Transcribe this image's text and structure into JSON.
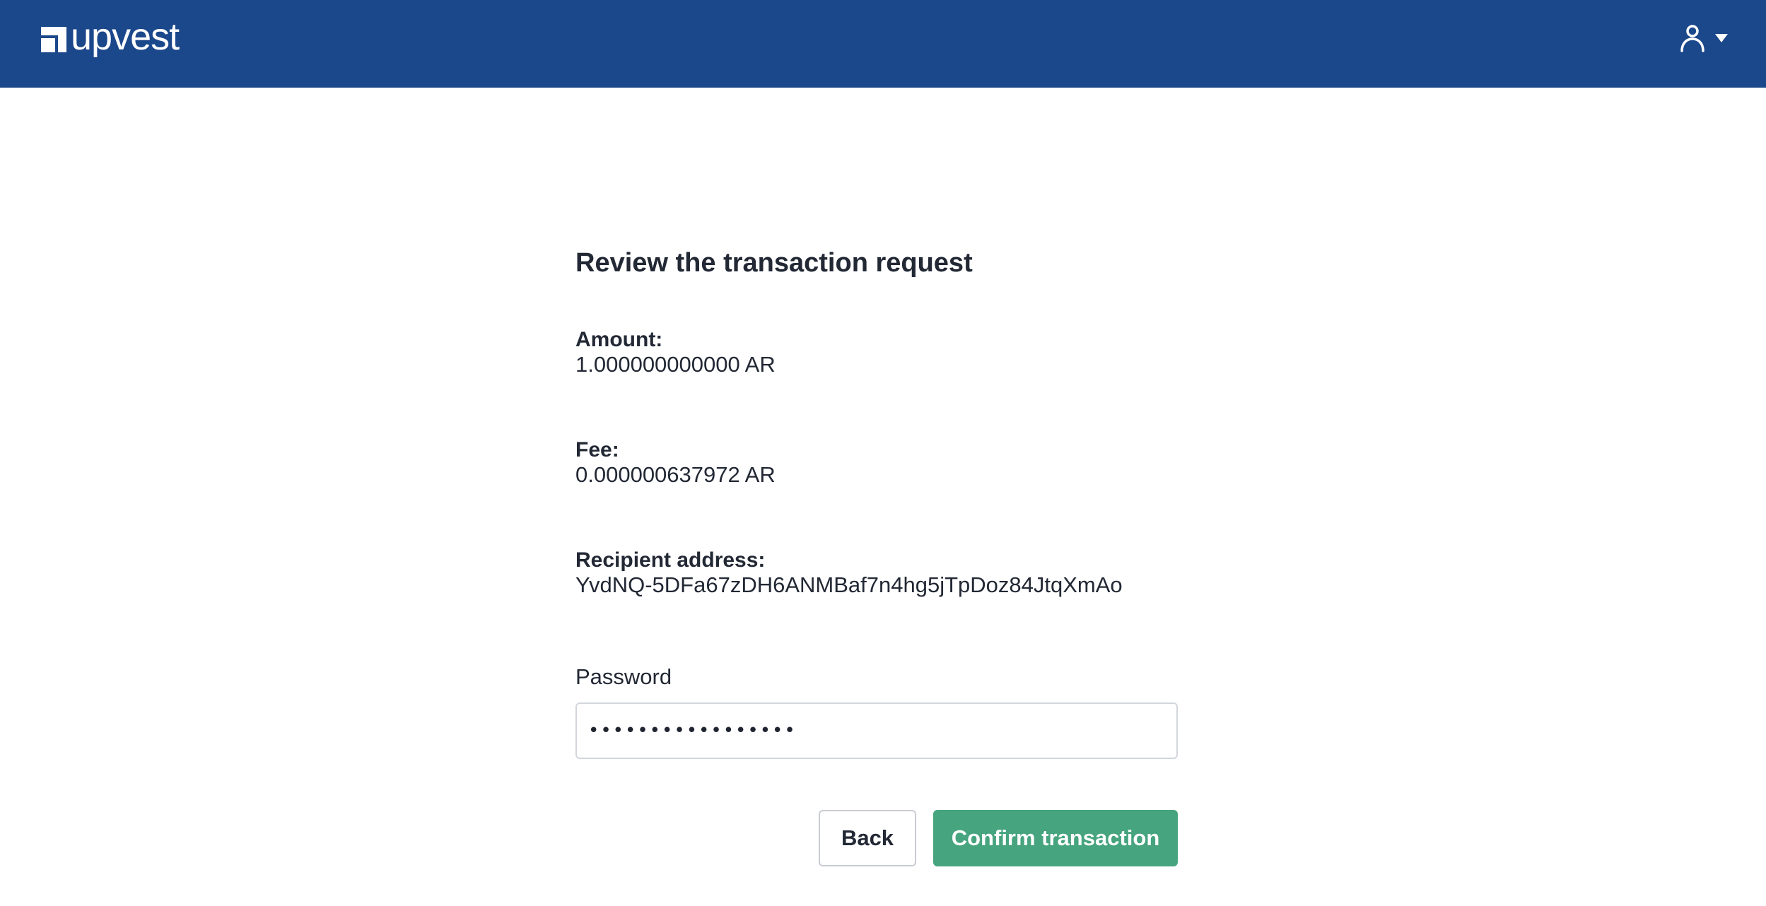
{
  "header": {
    "brand": "upvest",
    "brand_color": "#1b478b",
    "user_icon": "user-icon",
    "menu_icon": "chevron-down-icon"
  },
  "main": {
    "title": "Review the transaction request",
    "amount": {
      "label": "Amount:",
      "value": "1.000000000000 AR"
    },
    "fee": {
      "label": "Fee:",
      "value": "0.000000637972 AR"
    },
    "recipient": {
      "label": "Recipient address:",
      "value": "YvdNQ-5DFa67zDH6ANMBaf7n4hg5jTpDoz84JtqXmAo"
    },
    "password": {
      "label": "Password",
      "value": "•••••••••••••••••"
    },
    "buttons": {
      "back": "Back",
      "confirm": "Confirm transaction",
      "confirm_color": "#46a47e"
    }
  }
}
